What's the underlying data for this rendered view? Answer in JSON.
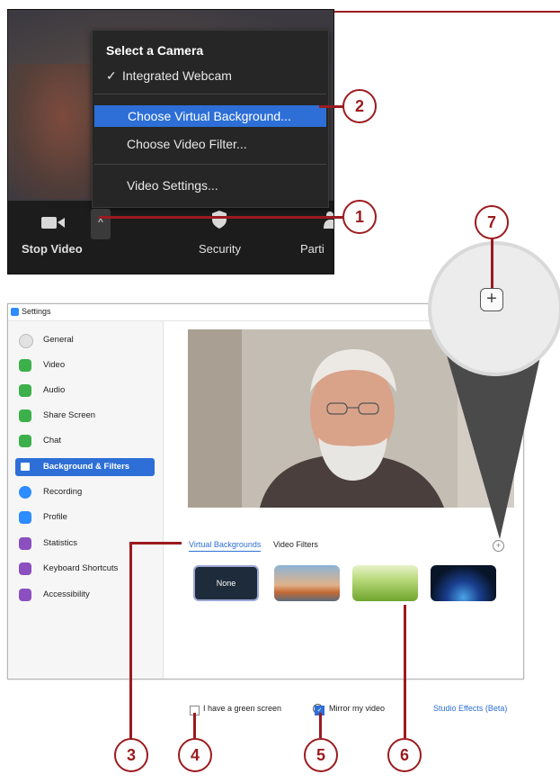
{
  "camera_menu": {
    "title": "Select a Camera",
    "items": [
      {
        "label": "Integrated Webcam",
        "checked": true
      },
      {
        "label": "Choose Virtual Background...",
        "highlighted": true
      },
      {
        "label": "Choose Video Filter..."
      },
      {
        "label": "Video Settings..."
      }
    ],
    "check_glyph": "✓"
  },
  "toolbar": {
    "caret": "^",
    "stop_video": "Stop Video",
    "security": "Security",
    "participants_partial": "Parti"
  },
  "callouts": [
    "1",
    "2",
    "3",
    "4",
    "5",
    "6",
    "7"
  ],
  "settings": {
    "title": "Settings",
    "nav": [
      {
        "label": "General",
        "color": "#d8d8d8"
      },
      {
        "label": "Video",
        "color": "#3cb04a"
      },
      {
        "label": "Audio",
        "color": "#3cb04a"
      },
      {
        "label": "Share Screen",
        "color": "#3cb04a"
      },
      {
        "label": "Chat",
        "color": "#3cb04a"
      },
      {
        "label": "Background & Filters",
        "color": "#ffffff",
        "selected": true
      },
      {
        "label": "Recording",
        "color": "#2d8cff"
      },
      {
        "label": "Profile",
        "color": "#2d8cff"
      },
      {
        "label": "Statistics",
        "color": "#8b4fbf"
      },
      {
        "label": "Keyboard Shortcuts",
        "color": "#8b4fbf"
      },
      {
        "label": "Accessibility",
        "color": "#8b4fbf"
      }
    ],
    "tabs": {
      "virtual_backgrounds": "Virtual Backgrounds",
      "video_filters": "Video Filters"
    },
    "thumb_none": "None",
    "green_screen": "I have a green screen",
    "mirror": "Mirror my video",
    "studio": "Studio Effects (Beta)",
    "help": "?",
    "mirror_checked": true,
    "green_checked": false
  },
  "magnifier": {
    "plus": "+"
  },
  "accent": "#9b1b1f",
  "highlight": "#2d6fd6"
}
